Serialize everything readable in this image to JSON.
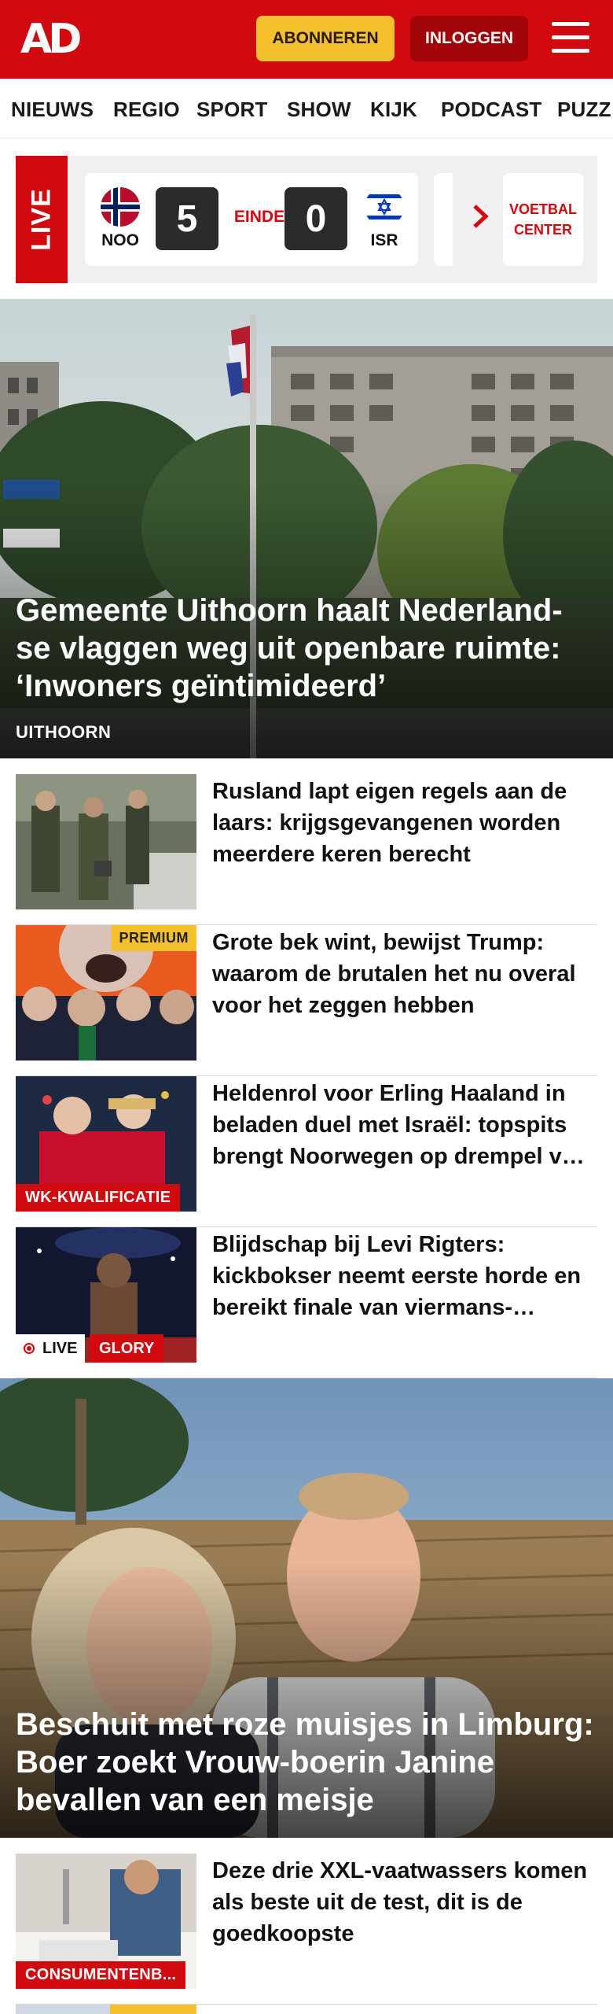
{
  "header": {
    "logo": "AD",
    "subscribe_label": "ABONNEREN",
    "login_label": "INLOGGEN",
    "menu_icon": "hamburger-menu-icon",
    "brand_color": "#d10a10",
    "subscribe_color": "#f4c02e"
  },
  "nav": {
    "items": [
      "NIEUWS",
      "REGIO",
      "SPORT",
      "SHOW",
      "KIJK",
      "PODCAST",
      "PUZZ"
    ]
  },
  "live": {
    "tag": "LIVE",
    "match": {
      "home_code": "NOO",
      "home_score": "5",
      "status": "EINDE",
      "away_score": "0",
      "away_code": "ISR"
    },
    "next_icon": "chevron-right-icon",
    "voetbal_center": "VOETBAL CENTER"
  },
  "hero1": {
    "title": "Gemeente Uithoorn haalt Nederland-se vlaggen weg uit openbare ruimte: ‘Inwoners geïntimideerd’",
    "label": "UITHOORN"
  },
  "articles": [
    {
      "title": "Rusland lapt eigen regels aan de laars: krijgsgevangenen worden meerdere keren berecht"
    },
    {
      "title": "Grote bek wint, bewijst Trump: waarom de brutalen het nu overal voor het zeggen hebben",
      "badge": "PREMIUM"
    },
    {
      "title": "Heldenrol voor Erling Haaland in beladen duel met Israël: topspits brengt Noorwegen op drempel van WK",
      "badge": "WK-KWALIFICATIE"
    },
    {
      "title": "Blijdschap bij Levi Rigters: kickbokser neemt eerste horde en bereikt finale van viermans-toernooi",
      "live": "LIVE",
      "badge": "GLORY"
    }
  ],
  "hero2": {
    "title": "Beschuit met roze muisjes in Limburg: Boer zoekt Vrouw-boerin Janine bevallen van een meisje"
  },
  "articles2": [
    {
      "title": "Deze drie XXL-vaatwassers komen als beste uit de test, dit is de goedkoopste",
      "badge": "CONSUMENTENB..."
    }
  ]
}
